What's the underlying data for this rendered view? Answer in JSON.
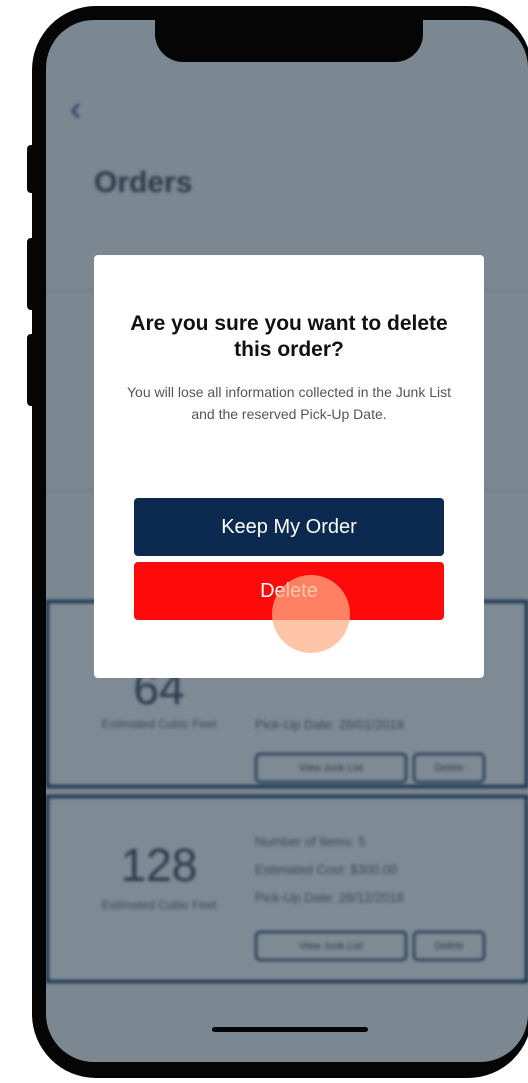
{
  "screen": {
    "back_icon": "chevron-left-icon",
    "title": "Orders",
    "orders": [
      {
        "cubic_feet": "64",
        "cubic_label": "Estimated Cubic Feet",
        "pickup": "Pick-Up Date: 28/01/2019",
        "view_label": "View Junk List",
        "delete_label": "Delete"
      },
      {
        "cubic_feet": "128",
        "cubic_label": "Estimated Cubic Feet",
        "items": "Number of Items: 5",
        "cost": "Estimated Cost: $300.00",
        "pickup": "Pick-Up Date: 28/12/2018",
        "view_label": "View Junk List",
        "delete_label": "Delete"
      }
    ]
  },
  "dialog": {
    "title": "Are you sure you want to delete this order?",
    "message": "You will lose all information collected in the Junk List and the reserved Pick-Up Date.",
    "keep_label": "Keep My Order",
    "delete_label": "Delete"
  },
  "colors": {
    "navy": "#0c2a50",
    "danger": "#ff0a0a",
    "overlay": "#7b8791",
    "touch_indicator": "#ffaf87"
  }
}
